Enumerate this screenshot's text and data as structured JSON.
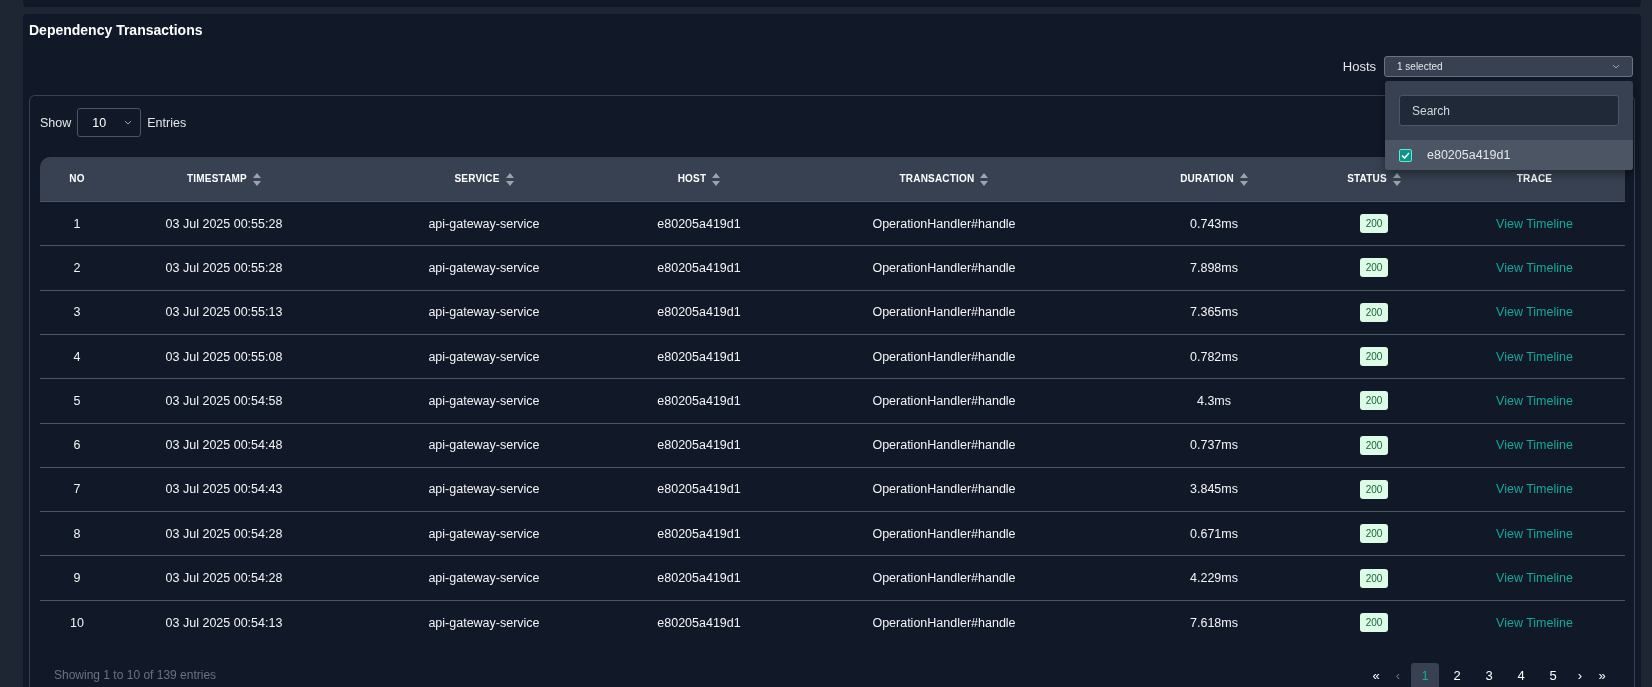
{
  "panel": {
    "title": "Dependency Transactions"
  },
  "hosts_filter": {
    "label": "Hosts",
    "value": "1 selected",
    "expanded": true,
    "search": {
      "placeholder": "Search"
    },
    "options": [
      {
        "label": "e80205a419d1",
        "checked": true
      }
    ]
  },
  "page_size": {
    "label_before": "Show",
    "value": "10",
    "label_after": "Entries"
  },
  "table": {
    "columns": [
      {
        "label": "NO",
        "sortable": false
      },
      {
        "label": "TIMESTAMP",
        "sortable": true
      },
      {
        "label": "SERVICE",
        "sortable": true
      },
      {
        "label": "HOST",
        "sortable": true
      },
      {
        "label": "TRANSACTION",
        "sortable": true
      },
      {
        "label": "DURATION",
        "sortable": true
      },
      {
        "label": "STATUS",
        "sortable": true
      },
      {
        "label": "TRACE",
        "sortable": false
      }
    ],
    "rows": [
      {
        "no": "1",
        "timestamp": "03 Jul 2025 00:55:28",
        "service": "api-gateway-service",
        "host": "e80205a419d1",
        "transaction": "OperationHandler#handle",
        "duration": "0.743ms",
        "status": "200",
        "trace": "View Timeline"
      },
      {
        "no": "2",
        "timestamp": "03 Jul 2025 00:55:28",
        "service": "api-gateway-service",
        "host": "e80205a419d1",
        "transaction": "OperationHandler#handle",
        "duration": "7.898ms",
        "status": "200",
        "trace": "View Timeline"
      },
      {
        "no": "3",
        "timestamp": "03 Jul 2025 00:55:13",
        "service": "api-gateway-service",
        "host": "e80205a419d1",
        "transaction": "OperationHandler#handle",
        "duration": "7.365ms",
        "status": "200",
        "trace": "View Timeline"
      },
      {
        "no": "4",
        "timestamp": "03 Jul 2025 00:55:08",
        "service": "api-gateway-service",
        "host": "e80205a419d1",
        "transaction": "OperationHandler#handle",
        "duration": "0.782ms",
        "status": "200",
        "trace": "View Timeline"
      },
      {
        "no": "5",
        "timestamp": "03 Jul 2025 00:54:58",
        "service": "api-gateway-service",
        "host": "e80205a419d1",
        "transaction": "OperationHandler#handle",
        "duration": "4.3ms",
        "status": "200",
        "trace": "View Timeline"
      },
      {
        "no": "6",
        "timestamp": "03 Jul 2025 00:54:48",
        "service": "api-gateway-service",
        "host": "e80205a419d1",
        "transaction": "OperationHandler#handle",
        "duration": "0.737ms",
        "status": "200",
        "trace": "View Timeline"
      },
      {
        "no": "7",
        "timestamp": "03 Jul 2025 00:54:43",
        "service": "api-gateway-service",
        "host": "e80205a419d1",
        "transaction": "OperationHandler#handle",
        "duration": "3.845ms",
        "status": "200",
        "trace": "View Timeline"
      },
      {
        "no": "8",
        "timestamp": "03 Jul 2025 00:54:28",
        "service": "api-gateway-service",
        "host": "e80205a419d1",
        "transaction": "OperationHandler#handle",
        "duration": "0.671ms",
        "status": "200",
        "trace": "View Timeline"
      },
      {
        "no": "9",
        "timestamp": "03 Jul 2025 00:54:28",
        "service": "api-gateway-service",
        "host": "e80205a419d1",
        "transaction": "OperationHandler#handle",
        "duration": "4.229ms",
        "status": "200",
        "trace": "View Timeline"
      },
      {
        "no": "10",
        "timestamp": "03 Jul 2025 00:54:13",
        "service": "api-gateway-service",
        "host": "e80205a419d1",
        "transaction": "OperationHandler#handle",
        "duration": "7.618ms",
        "status": "200",
        "trace": "View Timeline"
      }
    ]
  },
  "footer": {
    "summary": "Showing 1 to 10 of 139 entries",
    "pagination": [
      {
        "label": "«",
        "kind": "first",
        "disabled": false,
        "selected": false
      },
      {
        "label": "‹",
        "kind": "prev",
        "disabled": true,
        "selected": false
      },
      {
        "label": "1",
        "kind": "page",
        "disabled": false,
        "selected": true
      },
      {
        "label": "2",
        "kind": "page",
        "disabled": false,
        "selected": false
      },
      {
        "label": "3",
        "kind": "page",
        "disabled": false,
        "selected": false
      },
      {
        "label": "4",
        "kind": "page",
        "disabled": false,
        "selected": false
      },
      {
        "label": "5",
        "kind": "page",
        "disabled": false,
        "selected": false
      },
      {
        "label": "›",
        "kind": "next",
        "disabled": false,
        "selected": false
      },
      {
        "label": "»",
        "kind": "last",
        "disabled": false,
        "selected": false
      }
    ]
  }
}
